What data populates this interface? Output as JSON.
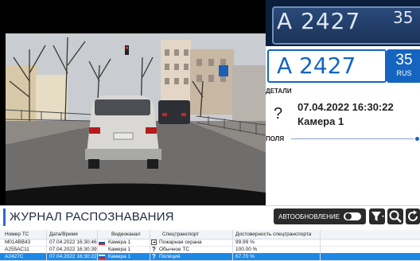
{
  "plate": {
    "photo_number": "А 2427",
    "photo_region": "35",
    "main": "А 2427",
    "region": "35",
    "country": "RUS"
  },
  "details": {
    "label": "ДЕТАЛИ",
    "status_icon": "?",
    "datetime": "07.04.2022 16:30:22",
    "camera": "Камера 1"
  },
  "fields": {
    "label": "ПОЛЯ"
  },
  "journal": {
    "title": "ЖУРНАЛ РАСПОЗНАВАНИЯ",
    "auto_refresh_label": "АВТООБНОВЛЕНИЕ",
    "auto_refresh_on": true
  },
  "table": {
    "columns": [
      "Номер ТС",
      "Дата/Время",
      "Видеоканал",
      "Спецтранспорт",
      "Достоверность спецтранспорта"
    ],
    "rows": [
      {
        "plate": "М014ВВ43",
        "datetime": "07.04.2022 16:30:46",
        "camera": "Камера 1",
        "icon": "exit-icon",
        "special": "Пожарная охрана",
        "confidence": "99.99 %"
      },
      {
        "plate": "А255АС11",
        "datetime": "07.04.2022 16:30:39",
        "camera": "Камера 1",
        "icon": "?",
        "special": "Обычное ТС",
        "confidence": "100.00 %"
      },
      {
        "plate": "А2427С",
        "datetime": "07.04.2022 16:30:22",
        "camera": "Камера 1",
        "icon": "?",
        "special": "Полиция",
        "confidence": "67.70 %",
        "selected": true
      }
    ]
  },
  "colors": {
    "accent": "#1565c0",
    "selected_row": "#1e88e5",
    "toolbar_button": "#2b2b2b"
  }
}
